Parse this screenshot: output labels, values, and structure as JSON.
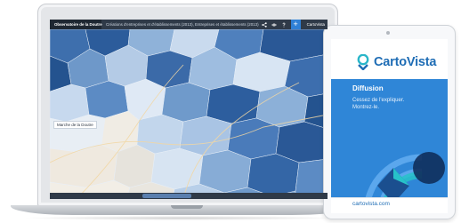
{
  "laptop": {
    "app_title": "Observatoire de la Doutre",
    "map_title": "Créations d'entreprises et d'établissements (2013), Entreprises et établissements (2013)",
    "add_button": "+",
    "brand_badge": "CartoVista",
    "map_label": "Marche de la Doutre",
    "toolbar_icons": [
      "share-icon",
      "eye-icon",
      "help-icon"
    ]
  },
  "tablet": {
    "brand": "CartoVista",
    "panel_title": "Diffusion",
    "panel_text_line1": "Cessez de l'expliquer.",
    "panel_text_line2": "Montrez-le.",
    "url": "cartovista.com"
  },
  "colors": {
    "brand_blue": "#1f6db5",
    "panel_blue": "#2f86d7",
    "app_bar": "#2f3a48",
    "map_dark": "#24538f",
    "map_light": "#c9daee"
  }
}
